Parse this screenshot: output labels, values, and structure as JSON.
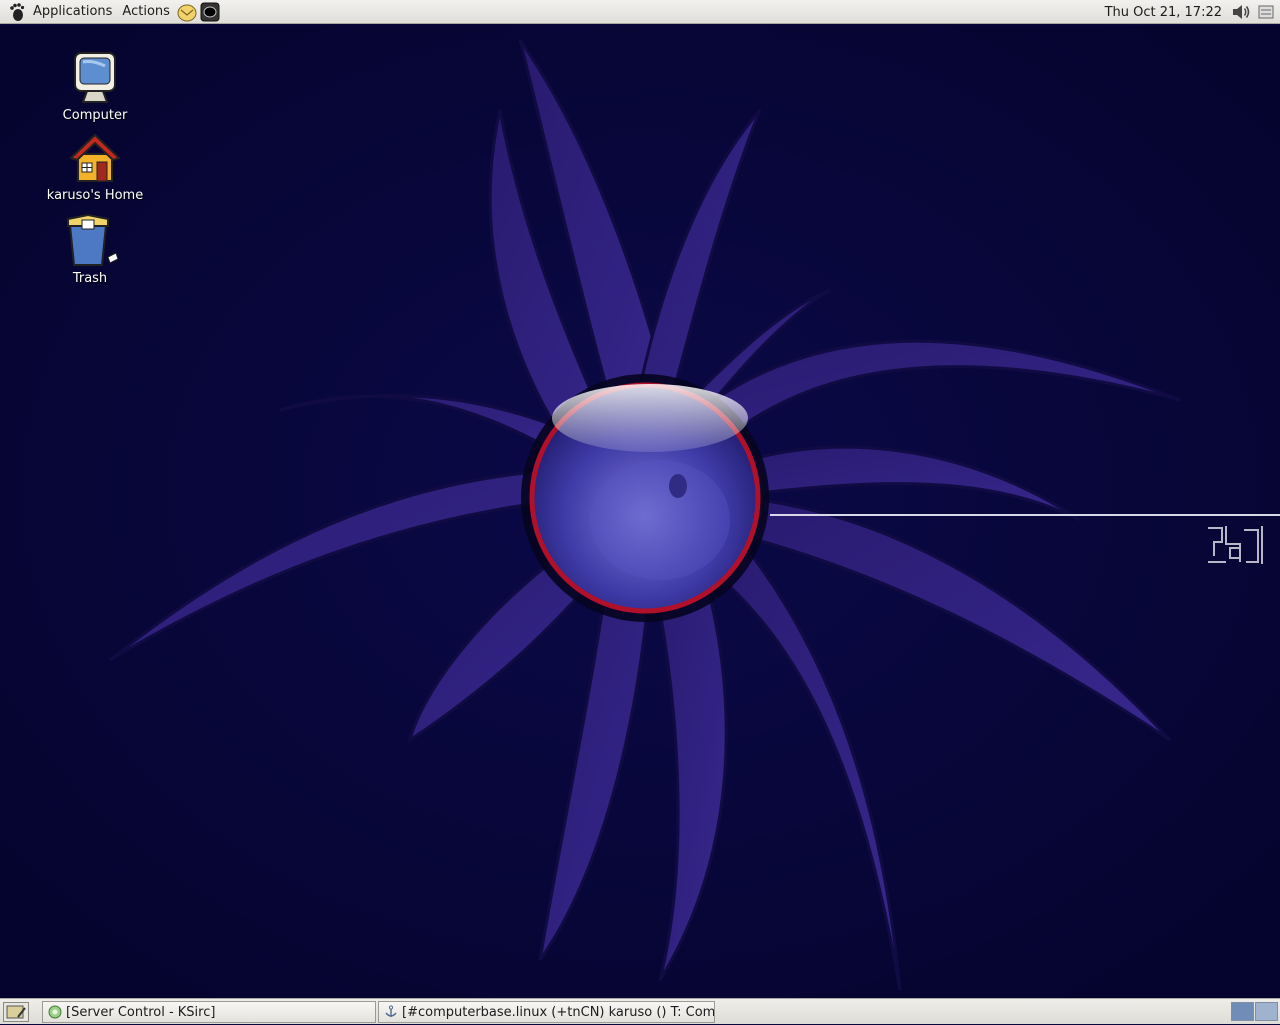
{
  "top_panel": {
    "menus": [
      "Applications",
      "Actions"
    ],
    "launchers": [
      "mail-launcher-icon",
      "terminal-launcher-icon"
    ],
    "clock": "Thu Oct 21, 17:22",
    "icons": [
      "gnome-foot-icon",
      "volume-icon",
      "tray-icon"
    ]
  },
  "desktop": {
    "icons": [
      {
        "label": "Computer",
        "icon": "computer-icon"
      },
      {
        "label": "karuso's Home",
        "icon": "home-icon"
      },
      {
        "label": "Trash",
        "icon": "trash-icon"
      }
    ]
  },
  "taskbar": {
    "buttons": [
      {
        "title": "[Server Control - KSirc]",
        "icon": "ksirc-icon"
      },
      {
        "title": "[#computerbase.linux (+tnCN) karuso () T: Comp",
        "icon": "anchor-icon"
      }
    ],
    "workspaces": 2,
    "active_workspace": 1
  },
  "colors": {
    "background": "#07063a",
    "petals": "#2d1f7a",
    "orb_ring": "#b0102a",
    "panel": "#e8e6e1"
  }
}
